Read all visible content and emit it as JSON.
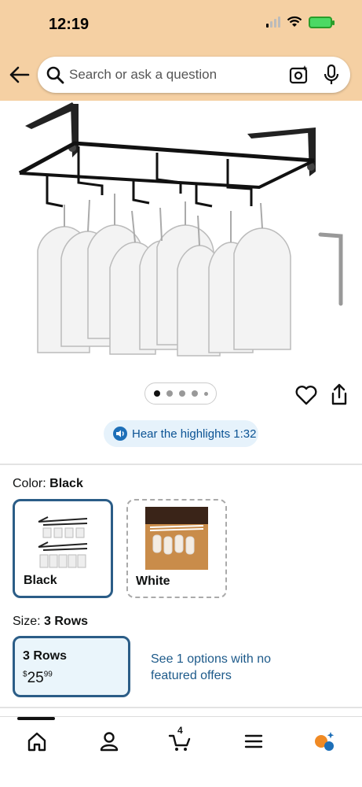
{
  "status": {
    "time": "12:19"
  },
  "search": {
    "placeholder": "Search or ask a question"
  },
  "carousel": {
    "count": 5,
    "active_index": 0
  },
  "audio": {
    "label": "Hear the highlights 1:32"
  },
  "color": {
    "label": "Color:",
    "selected": "Black",
    "options": [
      {
        "label": "Black"
      },
      {
        "label": "White"
      }
    ]
  },
  "size": {
    "label": "Size:",
    "selected": "3 Rows",
    "option_name": "3 Rows",
    "price_symbol": "$",
    "price_whole": "25",
    "price_fraction": "99",
    "other_offers": "See 1 options with no featured offers"
  },
  "cart": {
    "count": "4"
  },
  "theme": {
    "header_bg": "#f5d0a3",
    "link_color": "#1d5a8a",
    "selected_border": "#2b5d87"
  }
}
